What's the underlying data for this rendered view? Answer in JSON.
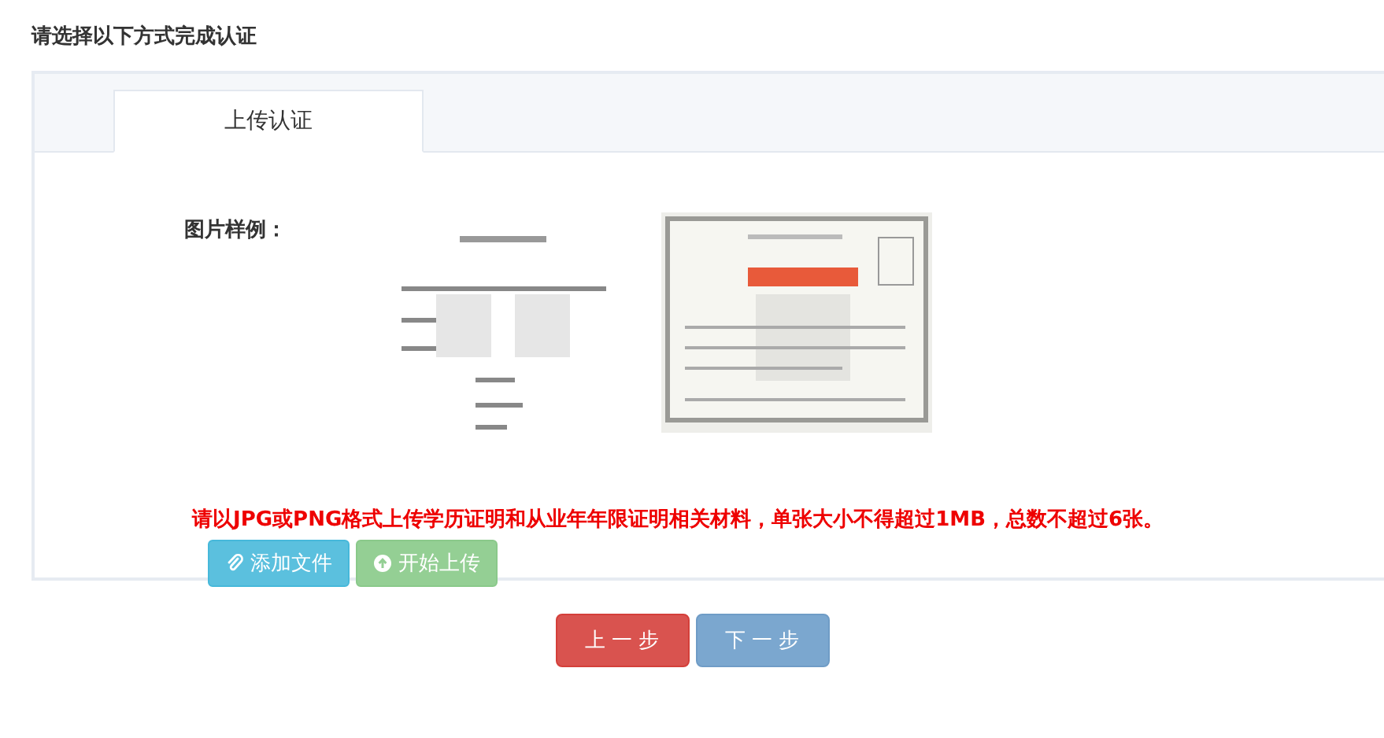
{
  "heading": "请选择以下方式完成认证",
  "tabs": [
    {
      "label": "上传认证",
      "selected": true
    }
  ],
  "sample": {
    "label": "图片样例："
  },
  "notice": "请以JPG或PNG格式上传学历证明和从业年年限证明相关材料，单张大小不得超过1MB，总数不超过6张。",
  "upload_buttons": [
    {
      "kind": "add",
      "label": "添加文件",
      "disabled": false
    },
    {
      "kind": "start",
      "label": "开始上传",
      "disabled": true
    }
  ],
  "nav_buttons": [
    {
      "kind": "prev",
      "label": "上 一 步"
    },
    {
      "kind": "next",
      "label": "下 一 步"
    }
  ]
}
